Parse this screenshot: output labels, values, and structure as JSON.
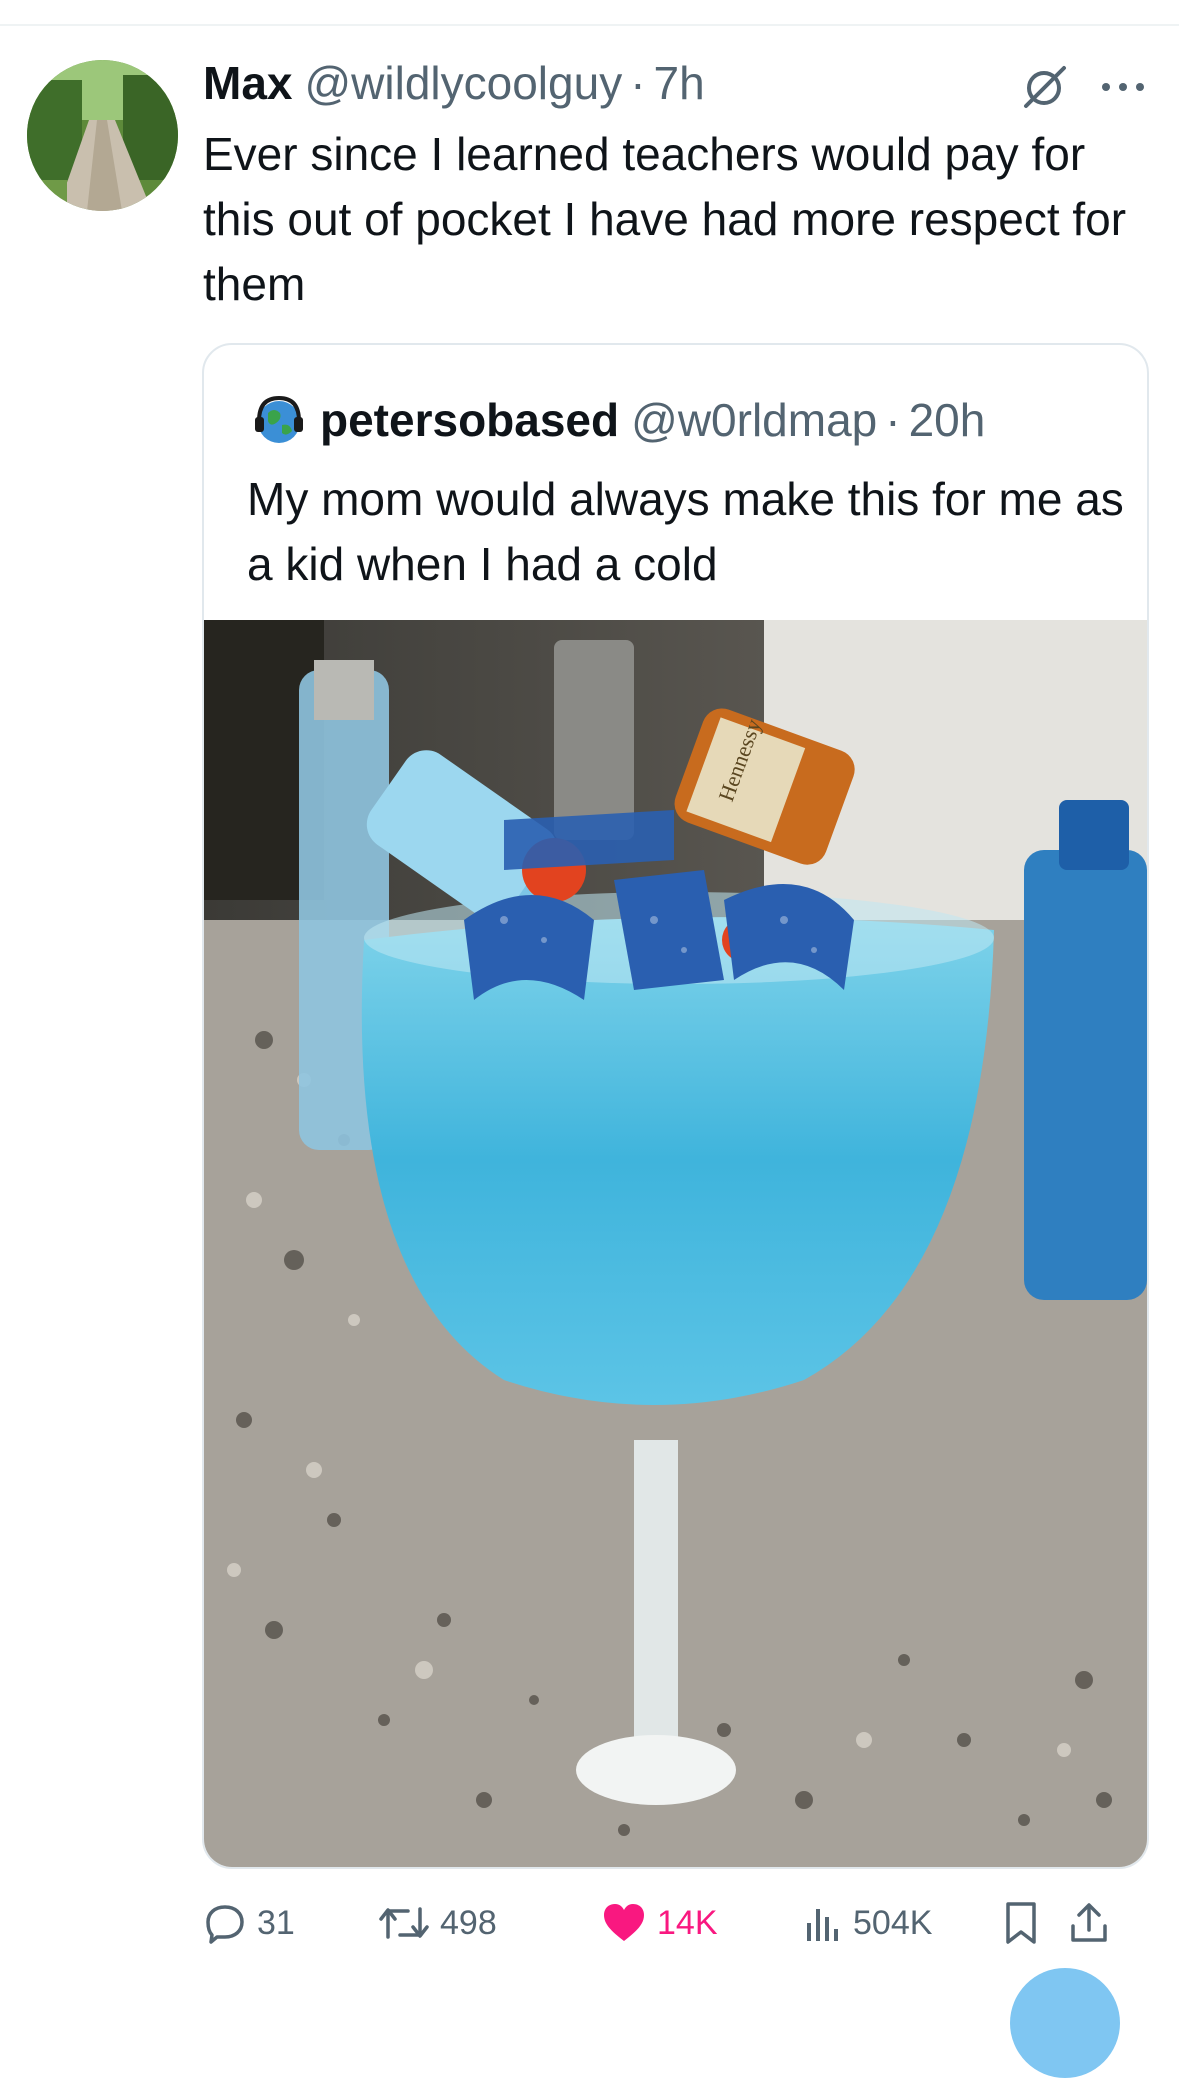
{
  "tweet": {
    "author_name": "Max",
    "author_handle": "@wildlycoolguy",
    "separator": "·",
    "time": "7h",
    "text": "Ever since I learned teachers would pay for this out of pocket I have had more respect for them",
    "avatar_icon": "avatar-country-road-photo"
  },
  "quoted_tweet": {
    "author_name": "petersobased",
    "author_handle": "@w0rldmap",
    "separator": "·",
    "time": "20h",
    "text": "My mom would always make this for me as a kid when I had a cold",
    "avatar_icon": "globe-headphones-avatar",
    "image_label": "Hennessy"
  },
  "actions": {
    "replies": "31",
    "retweets": "498",
    "likes": "14K",
    "views": "504K"
  },
  "colors": {
    "text_primary": "#0f1419",
    "text_secondary": "#536471",
    "like_active": "#f91880",
    "border": "#e1e8ed"
  }
}
